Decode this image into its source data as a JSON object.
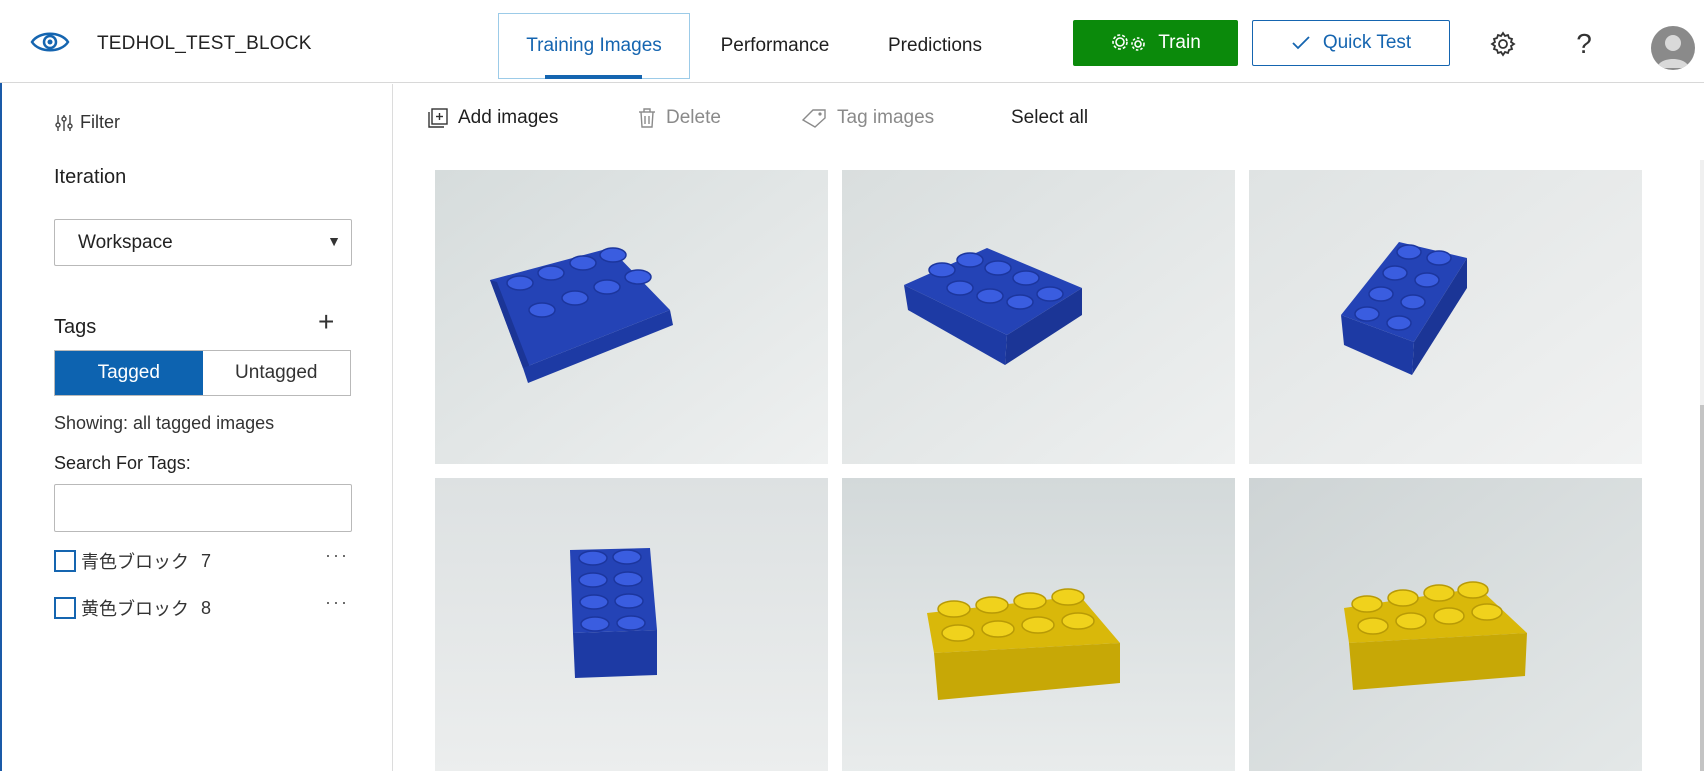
{
  "header": {
    "project_title": "TEDHOL_TEST_BLOCK",
    "tabs": [
      {
        "label": "Training Images",
        "active": true
      },
      {
        "label": "Performance",
        "active": false
      },
      {
        "label": "Predictions",
        "active": false
      }
    ],
    "train_label": "Train",
    "quick_test_label": "Quick Test",
    "help_label": "?"
  },
  "sidebar": {
    "filter_label": "Filter",
    "iteration_title": "Iteration",
    "iteration_value": "Workspace",
    "tags_title": "Tags",
    "toggle": {
      "tagged": "Tagged",
      "untagged": "Untagged"
    },
    "showing_text": "Showing: all tagged images",
    "search_label": "Search For Tags:",
    "search_value": "",
    "tags": [
      {
        "name": "青色ブロック",
        "count": "7"
      },
      {
        "name": "黄色ブロック",
        "count": "8"
      }
    ]
  },
  "toolbar": {
    "add_images": "Add images",
    "delete": "Delete",
    "tag_images": "Tag images",
    "select_all": "Select all"
  },
  "images": [
    {
      "brick_color": "#2b4fc4",
      "orientation": "angled-left"
    },
    {
      "brick_color": "#2b4fc4",
      "orientation": "angled-right"
    },
    {
      "brick_color": "#2b4fc4",
      "orientation": "diagonal"
    },
    {
      "brick_color": "#2b4fc4",
      "orientation": "vertical"
    },
    {
      "brick_color": "#e4c40c",
      "orientation": "horizontal"
    },
    {
      "brick_color": "#e4c40c",
      "orientation": "horizontal"
    }
  ],
  "colors": {
    "accent": "#1565b0",
    "train_green": "#0b8a0b",
    "blue_brick": "#2b4fc4",
    "yellow_brick": "#e4c40c"
  }
}
